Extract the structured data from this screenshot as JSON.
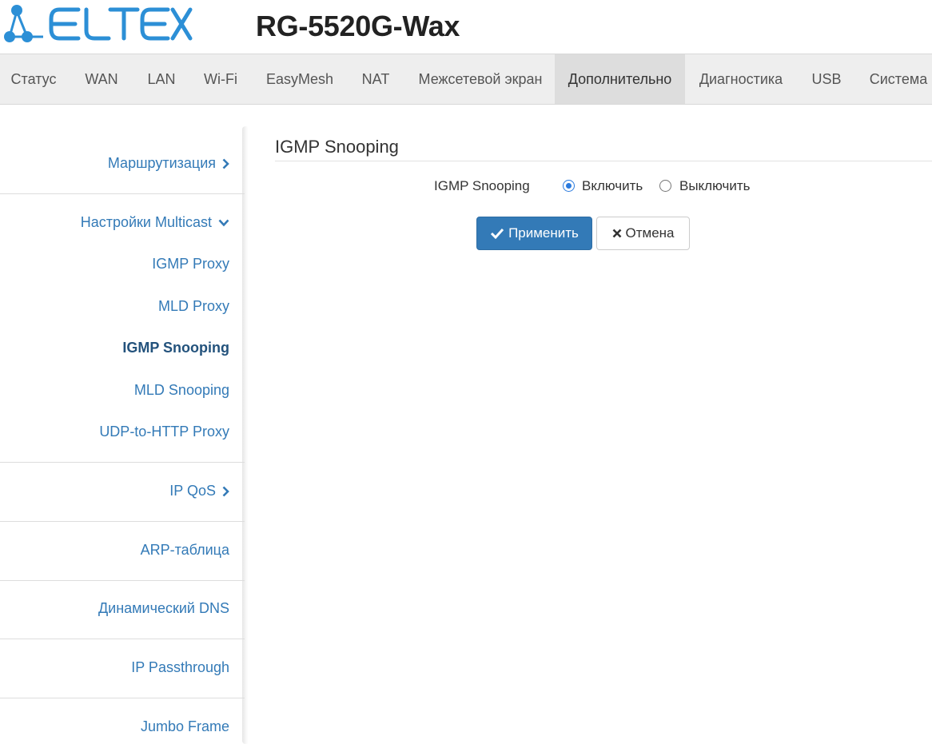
{
  "header": {
    "logo_text": "ELTEX",
    "model": "RG-5520G-Wax"
  },
  "topnav": {
    "items": [
      {
        "label": "Статус"
      },
      {
        "label": "WAN"
      },
      {
        "label": "LAN"
      },
      {
        "label": "Wi-Fi"
      },
      {
        "label": "EasyMesh"
      },
      {
        "label": "NAT"
      },
      {
        "label": "Межсетевой экран"
      },
      {
        "label": "Дополнительно",
        "active": true
      },
      {
        "label": "Диагностика"
      },
      {
        "label": "USB"
      },
      {
        "label": "Система"
      }
    ]
  },
  "sidebar": {
    "routing": "Маршрутизация",
    "multicast": "Настройки Multicast",
    "igmp_proxy": "IGMP Proxy",
    "mld_proxy": "MLD Proxy",
    "igmp_snooping": "IGMP Snooping",
    "mld_snooping": "MLD Snooping",
    "udp_http_proxy": "UDP-to-HTTP Proxy",
    "ip_qos": "IP QoS",
    "arp_table": "ARP-таблица",
    "dynamic_dns": "Динамический DNS",
    "ip_passthrough": "IP Passthrough",
    "jumbo_frame": "Jumbo Frame"
  },
  "content": {
    "title": "IGMP Snooping",
    "field_label": "IGMP Snooping",
    "options": {
      "enable": "Включить",
      "disable": "Выключить",
      "selected": "enable"
    },
    "apply_label": "Применить",
    "cancel_label": "Отмена"
  },
  "colors": {
    "brand_blue": "#2c8fd6",
    "link": "#337ab7",
    "primary_button": "#337ab7",
    "nav_bg": "#eeeeee",
    "nav_active_bg": "#dddddd"
  },
  "icons": {
    "logo_mark": "eltex-network-logo",
    "chevron_right": "chevron-right-icon",
    "chevron_down": "chevron-down-icon",
    "check": "check-icon",
    "close": "close-icon"
  }
}
